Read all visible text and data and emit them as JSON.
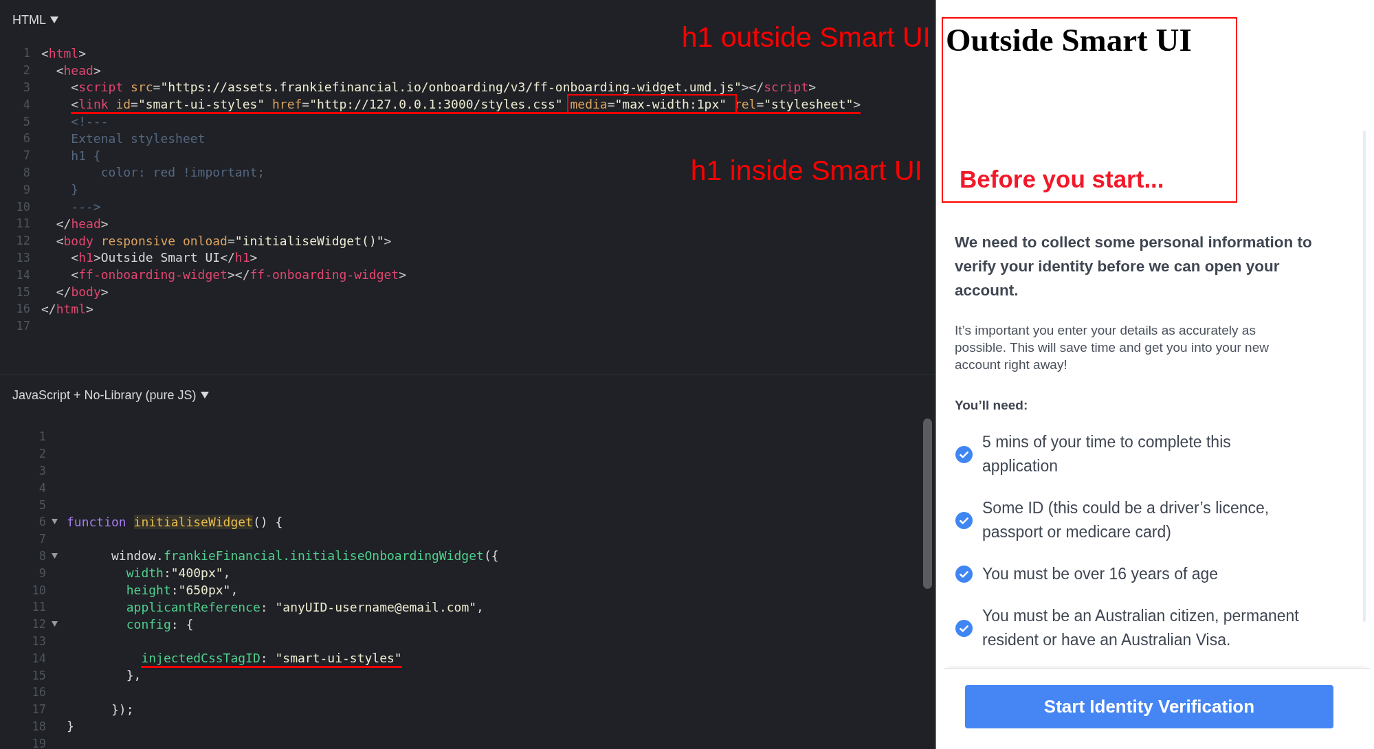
{
  "html_editor": {
    "language": "HTML",
    "lines": [
      {
        "number": "1",
        "tokens": [
          {
            "kind": "punct",
            "text": "<"
          },
          {
            "kind": "tag",
            "text": "html"
          },
          {
            "kind": "punct",
            "text": ">"
          }
        ]
      },
      {
        "number": "2",
        "tokens": [
          {
            "kind": "punct",
            "text": "  <"
          },
          {
            "kind": "tag",
            "text": "head"
          },
          {
            "kind": "punct",
            "text": ">"
          }
        ]
      },
      {
        "number": "3",
        "tokens": [
          {
            "kind": "punct",
            "text": "    <"
          },
          {
            "kind": "tag",
            "text": "script"
          },
          {
            "kind": "attr",
            "text": " src"
          },
          {
            "kind": "punct",
            "text": "="
          },
          {
            "kind": "str",
            "text": "\"https://assets.frankiefinancial.io/onboarding/v3/ff-onboarding-widget.umd.js\""
          },
          {
            "kind": "punct",
            "text": "></"
          },
          {
            "kind": "tag",
            "text": "script"
          },
          {
            "kind": "punct",
            "text": ">"
          }
        ]
      },
      {
        "number": "4",
        "underline": true,
        "tokens": [
          {
            "kind": "punct",
            "text": "    <"
          },
          {
            "kind": "tag",
            "text": "link"
          },
          {
            "kind": "attr",
            "text": " id"
          },
          {
            "kind": "punct",
            "text": "="
          },
          {
            "kind": "str",
            "text": "\"smart-ui-styles\""
          },
          {
            "kind": "attr",
            "text": " href"
          },
          {
            "kind": "punct",
            "text": "="
          },
          {
            "kind": "str",
            "text": "\"http://127.0.0.1:3000/styles.css\" "
          },
          {
            "kind": "attr",
            "text": "media",
            "boxed": true
          },
          {
            "kind": "punct",
            "text": "=",
            "boxed": true
          },
          {
            "kind": "str",
            "text": "\"max-width:1px\" ",
            "boxed": true
          },
          {
            "kind": "attr",
            "text": "rel"
          },
          {
            "kind": "punct",
            "text": "="
          },
          {
            "kind": "str",
            "text": "\"stylesheet\""
          },
          {
            "kind": "punct",
            "text": ">"
          }
        ]
      },
      {
        "number": "5",
        "tokens": [
          {
            "kind": "comment",
            "text": "    <!---"
          }
        ]
      },
      {
        "number": "6",
        "tokens": [
          {
            "kind": "comment",
            "text": "    Extenal stylesheet"
          }
        ]
      },
      {
        "number": "7",
        "tokens": [
          {
            "kind": "comment",
            "text": "    h1 {"
          }
        ]
      },
      {
        "number": "8",
        "tokens": [
          {
            "kind": "comment",
            "text": "        color: red !important;"
          }
        ]
      },
      {
        "number": "9",
        "tokens": [
          {
            "kind": "comment",
            "text": "    }"
          }
        ]
      },
      {
        "number": "10",
        "tokens": [
          {
            "kind": "comment",
            "text": "    --->"
          }
        ]
      },
      {
        "number": "11",
        "tokens": [
          {
            "kind": "punct",
            "text": "  </"
          },
          {
            "kind": "tag",
            "text": "head"
          },
          {
            "kind": "punct",
            "text": ">"
          }
        ]
      },
      {
        "number": "12",
        "tokens": [
          {
            "kind": "punct",
            "text": "  <"
          },
          {
            "kind": "tag",
            "text": "body"
          },
          {
            "kind": "attr",
            "text": " responsive onload"
          },
          {
            "kind": "punct",
            "text": "="
          },
          {
            "kind": "str",
            "text": "\"initialiseWidget()\""
          },
          {
            "kind": "punct",
            "text": ">"
          }
        ]
      },
      {
        "number": "13",
        "tokens": [
          {
            "kind": "punct",
            "text": "    <"
          },
          {
            "kind": "tag",
            "text": "h1"
          },
          {
            "kind": "punct",
            "text": ">"
          },
          {
            "kind": "plain",
            "text": "Outside Smart UI"
          },
          {
            "kind": "punct",
            "text": "</"
          },
          {
            "kind": "tag",
            "text": "h1"
          },
          {
            "kind": "punct",
            "text": ">"
          }
        ]
      },
      {
        "number": "14",
        "tokens": [
          {
            "kind": "punct",
            "text": "    <"
          },
          {
            "kind": "tag",
            "text": "ff-onboarding-widget"
          },
          {
            "kind": "punct",
            "text": "></"
          },
          {
            "kind": "tag",
            "text": "ff-onboarding-widget"
          },
          {
            "kind": "punct",
            "text": ">"
          }
        ]
      },
      {
        "number": "15",
        "tokens": [
          {
            "kind": "punct",
            "text": "  </"
          },
          {
            "kind": "tag",
            "text": "body"
          },
          {
            "kind": "punct",
            "text": ">"
          }
        ]
      },
      {
        "number": "16",
        "tokens": [
          {
            "kind": "punct",
            "text": "</"
          },
          {
            "kind": "tag",
            "text": "html"
          },
          {
            "kind": "punct",
            "text": ">"
          }
        ]
      },
      {
        "number": "17"
      }
    ]
  },
  "annotations": [
    {
      "text": "h1 outside Smart UI"
    },
    {
      "text": "h1 inside Smart UI"
    }
  ],
  "js_editor": {
    "language": "JavaScript + No-Library (pure JS)",
    "lines": [
      {
        "number": "1"
      },
      {
        "number": "2"
      },
      {
        "number": "3"
      },
      {
        "number": "4"
      },
      {
        "number": "5"
      },
      {
        "number": "6",
        "expanded": true,
        "tokens": [
          {
            "kind": "kw",
            "text": "function "
          },
          {
            "kind": "fn",
            "text": "initialiseWidget"
          },
          {
            "kind": "plain",
            "text": "() {"
          }
        ]
      },
      {
        "number": "7"
      },
      {
        "number": "8",
        "expanded": true,
        "tokens": [
          {
            "kind": "plain",
            "text": "      window."
          },
          {
            "kind": "prop",
            "text": "frankieFinancial.initialiseOnboardingWidget"
          },
          {
            "kind": "plain",
            "text": "({"
          }
        ]
      },
      {
        "number": "9",
        "tokens": [
          {
            "kind": "prop",
            "text": "        width"
          },
          {
            "kind": "plain",
            "text": ":"
          },
          {
            "kind": "str",
            "text": "\"400px\""
          },
          {
            "kind": "plain",
            "text": ","
          }
        ]
      },
      {
        "number": "10",
        "tokens": [
          {
            "kind": "prop",
            "text": "        height"
          },
          {
            "kind": "plain",
            "text": ":"
          },
          {
            "kind": "str",
            "text": "\"650px\""
          },
          {
            "kind": "plain",
            "text": ","
          }
        ]
      },
      {
        "number": "11",
        "tokens": [
          {
            "kind": "prop",
            "text": "        applicantReference"
          },
          {
            "kind": "plain",
            "text": ": "
          },
          {
            "kind": "str",
            "text": "\"anyUID-username@email.com\""
          },
          {
            "kind": "plain",
            "text": ","
          }
        ]
      },
      {
        "number": "12",
        "expanded": true,
        "tokens": [
          {
            "kind": "prop",
            "text": "        config"
          },
          {
            "kind": "plain",
            "text": ": {"
          }
        ]
      },
      {
        "number": "13"
      },
      {
        "number": "14",
        "underline": true,
        "tokens": [
          {
            "kind": "prop",
            "text": "          injectedCssTagID"
          },
          {
            "kind": "plain",
            "text": ": "
          },
          {
            "kind": "str",
            "text": "\"smart-ui-styles\""
          }
        ]
      },
      {
        "number": "15",
        "tokens": [
          {
            "kind": "plain",
            "text": "        },"
          }
        ]
      },
      {
        "number": "16"
      },
      {
        "number": "17",
        "tokens": [
          {
            "kind": "plain",
            "text": "      });"
          }
        ]
      },
      {
        "number": "18",
        "tokens": [
          {
            "kind": "plain",
            "text": "}"
          }
        ]
      },
      {
        "number": "19"
      }
    ]
  },
  "preview": {
    "page_heading": "Outside Smart UI",
    "widget_heading": "Before you start...",
    "intro": "We need to collect some personal information to verify your identity before we can open your account.",
    "note": "It’s important you enter your details as accurately as possible. This will save time and get you into your new account right away!",
    "needs_label": "You’ll need:",
    "requirements": [
      {
        "text": "5 mins of your time to complete this application",
        "checked": true
      },
      {
        "text": "Some ID (this could be a driver’s licence, passport or medicare card)",
        "checked": true
      },
      {
        "text": "You must be over 16 years of age",
        "checked": true
      },
      {
        "text": "You must be an Australian citizen, permanent resident or have an Australian Visa.",
        "checked": true
      }
    ],
    "start_button": "Start Identity Verification"
  }
}
